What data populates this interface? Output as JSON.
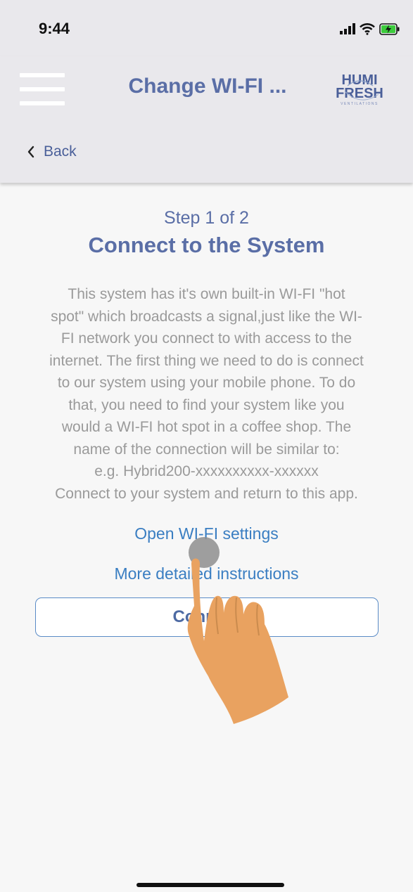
{
  "status_bar": {
    "time": "9:44"
  },
  "header": {
    "title": "Change WI-FI ...",
    "back_label": "Back",
    "logo": {
      "line1": "HUMI",
      "line2": "FRESH",
      "tagline": "VENTILATIONS"
    }
  },
  "main": {
    "step": "Step 1 of 2",
    "heading": "Connect to the System",
    "description_lines": [
      "This system has it's own built-in WI-FI \"hot",
      "spot\" which broadcasts a signal,just like the WI-",
      "FI network you connect to with access to the",
      "internet. The first thing we need to do is connect",
      "to our system using your mobile phone. To do",
      "that, you need to find your system like you",
      "would a WI-FI hot spot in a coffee shop. The",
      "name of the connection will be similar to:",
      "e.g. Hybrid200-xxxxxxxxxx-xxxxxx",
      "Connect to your system and return to this app."
    ],
    "open_wifi_link": "Open WI-FI settings",
    "more_instructions_link": "More detailed instructions",
    "connect_button": "Connect"
  },
  "colors": {
    "accent": "#5a6ea6",
    "link": "#3a7ec2",
    "header_bg": "#e9e8ec",
    "text_muted": "#9a9a9a",
    "hand_skin": "#e9a260"
  }
}
